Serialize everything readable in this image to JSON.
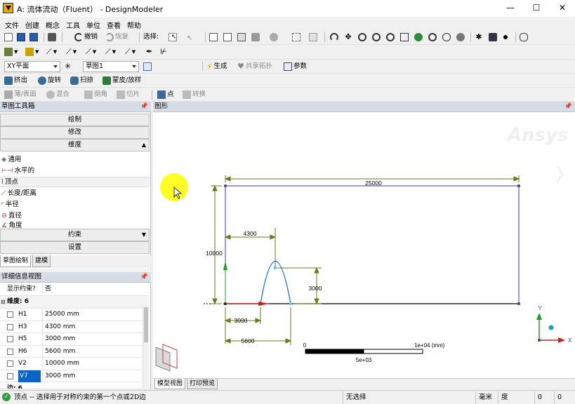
{
  "window": {
    "title": "A: 流体流动（Fluent） - DesignModeler",
    "minimize": "—",
    "maximize": "☐",
    "close": "✕"
  },
  "menu": [
    "文件",
    "创建",
    "概念",
    "工具",
    "单位",
    "查看",
    "帮助"
  ],
  "toolbar1": {
    "undo": "撤销",
    "redo": "恢复",
    "select_label": "选择:"
  },
  "toolbar3": {
    "plane": "XY平面",
    "sketch": "草图1",
    "generate": "生成",
    "share_topology": "共享拓扑",
    "parameters": "参数"
  },
  "toolbar4": {
    "extrude": "挤出",
    "revolve": "旋转",
    "sweep": "扫掠",
    "skin_loft": "蒙皮/放样"
  },
  "toolbar5": {
    "thin_surface": "薄/表面",
    "blend": "混合",
    "chamfer": "倒角",
    "slice": "切片",
    "point": "点",
    "convert": "转换"
  },
  "left_panel": {
    "title": "草图工具箱",
    "sections": {
      "draw": "绘制",
      "modify": "修改",
      "dimensions": "维度",
      "constraints": "约束",
      "settings": "设置"
    },
    "dim_tools": [
      "通用",
      "水平的",
      "顶点",
      "长度/距离",
      "半径",
      "直径",
      "角度"
    ],
    "tabs": {
      "sketching": "草图绘制",
      "modeling": "建模"
    }
  },
  "details": {
    "title": "详细信息视图",
    "show_constraints_label": "显示约束?",
    "show_constraints_value": "否",
    "group_label": "维度: 6",
    "rows": [
      {
        "name": "H1",
        "value": "25000 mm"
      },
      {
        "name": "H3",
        "value": "4300 mm"
      },
      {
        "name": "H5",
        "value": "3000 mm"
      },
      {
        "name": "H6",
        "value": "5600 mm"
      },
      {
        "name": "V2",
        "value": "10000 mm"
      },
      {
        "name": "V7",
        "value": "3000 mm"
      }
    ],
    "next_group": "边: 6"
  },
  "graphics": {
    "title": "图形",
    "watermark": "Ansys",
    "dims": {
      "h1": "25000",
      "h3": "4300",
      "h5": "3000",
      "h6": "5600",
      "v2": "10000",
      "v7": "3000"
    },
    "scale": {
      "zero": "0",
      "max": "1e+04 (mm)",
      "mid": "5e+03"
    },
    "triad": {
      "y": "Y",
      "x": "X"
    },
    "tabs": {
      "model_view": "模型视图",
      "print_preview": "打印预览"
    }
  },
  "status": {
    "message": "顶点 -- 选择用于对称约束的第一个点或2D边",
    "selection": "无选择",
    "length_unit": "毫米",
    "angle_unit": "度",
    "v1": "0",
    "v2": "0"
  }
}
